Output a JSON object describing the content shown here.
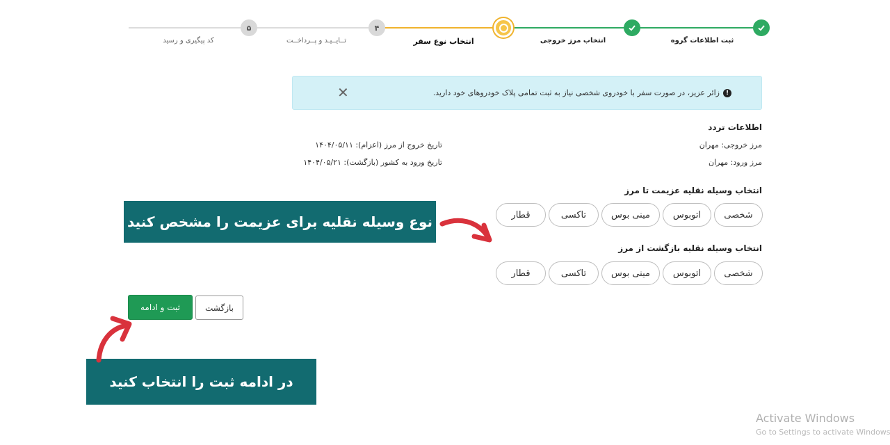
{
  "stepper": {
    "steps": [
      {
        "number": "",
        "label": "ثبت اطلاعات گروه",
        "state": "done"
      },
      {
        "number": "",
        "label": "انتخاب مرز خروجی",
        "state": "done"
      },
      {
        "number": "",
        "label": "انتخاب نوع سفر",
        "state": "current"
      },
      {
        "number": "۴",
        "label": "تــایــیـد و پــرداخــت",
        "state": "pending"
      },
      {
        "number": "۵",
        "label": "کد پیگیری و رسید",
        "state": "pending"
      }
    ],
    "colors": {
      "done": "#2eaa62",
      "current": "#f0b32d",
      "pending": "#d9d9d9"
    }
  },
  "alert": {
    "text": "زائر عزیز، در صورت سفر با خودروی شخصی نیاز به ثبت تمامی پلاک خودروهای خود دارید.",
    "info_icon": "info-icon",
    "close_icon": "close-icon",
    "close_glyph": "✕",
    "info_glyph": "!"
  },
  "trip_info": {
    "title": "اطلاعات تردد",
    "exit_border": "مرز خروجی: مهران",
    "entry_border": "مرز ورود: مهران",
    "exit_date": "تاریخ خروج از مرز (اعزام): ۱۴۰۴/۰۵/۱۱",
    "entry_date": "تاریخ ورود به کشور (بازگشت): ۱۴۰۴/۰۵/۲۱"
  },
  "outbound": {
    "title": "انتخاب وسیله نقلیه عزیمت تا مرز",
    "options": [
      "شخصی",
      "اتوبوس",
      "مینی بوس",
      "تاکسی",
      "قطار"
    ]
  },
  "return": {
    "title": "انتخاب وسیله نقلیه بازگشت از مرز",
    "options": [
      "شخصی",
      "اتوبوس",
      "مینی بوس",
      "تاکسی",
      "قطار"
    ]
  },
  "callouts": {
    "vehicle": "نوع وسیله نقلیه برای عزیمت را مشخص کنید",
    "submit": "در ادامه ثبت را انتخاب کنید",
    "color": "#126b70",
    "arrow_color": "#d9323c"
  },
  "buttons": {
    "submit": "ثبت و ادامه",
    "back": "بازگشت"
  },
  "watermark": {
    "line1": "Activate Windows",
    "line2": "Go to Settings to activate Windows"
  }
}
